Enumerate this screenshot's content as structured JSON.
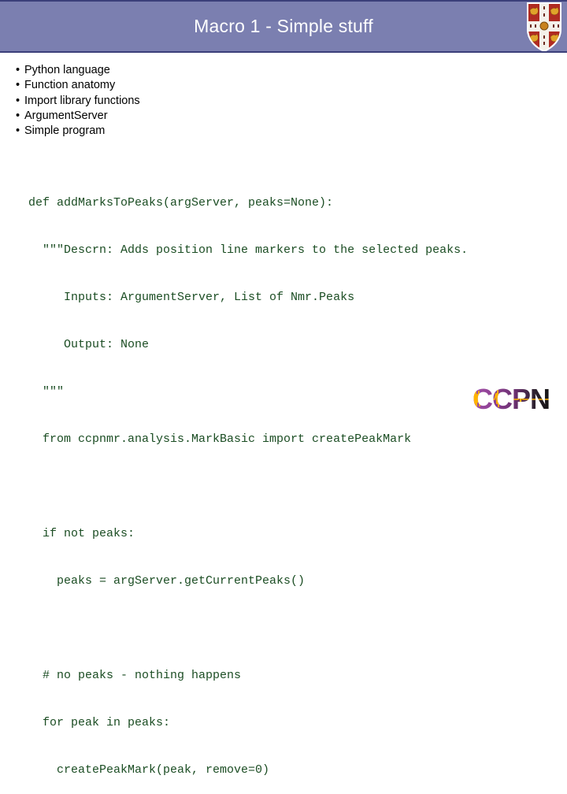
{
  "header": {
    "title": "Macro 1 - Simple stuff",
    "background_color": "#7b7fb0",
    "border_color": "#3b3f7a",
    "title_color": "#ffffff",
    "crest_name": "cambridge-university-crest"
  },
  "bullets": {
    "marker": "•",
    "items": [
      "Python language",
      "Function anatomy",
      "Import library functions",
      "ArgumentServer",
      "Simple program"
    ]
  },
  "code": {
    "color": "#1b4d23",
    "lines": [
      "def addMarksToPeaks(argServer, peaks=None):",
      "  \"\"\"Descrn: Adds position line markers to the selected peaks.",
      "     Inputs: ArgumentServer, List of Nmr.Peaks",
      "     Output: None",
      "  \"\"\"",
      "  from ccpnmr.analysis.MarkBasic import createPeakMark",
      "",
      "  if not peaks:",
      "    peaks = argServer.getCurrentPeaks()",
      "",
      "  # no peaks - nothing happens",
      "  for peak in peaks:",
      "    createPeakMark(peak, remove=0)"
    ]
  },
  "footer": {
    "logo_text": "CCPN",
    "logo_name": "ccpn-logo",
    "logo_gradient_start": "#9b4f9e",
    "logo_gradient_end": "#1a1a1a",
    "logo_waveform_color": "#ffb400"
  }
}
